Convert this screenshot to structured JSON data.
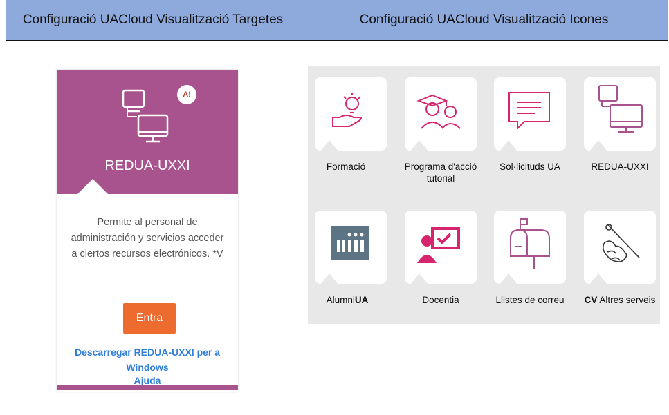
{
  "headers": {
    "left": "Configuració UACloud Visualització Targetes",
    "right": "Configuració UACloud Visualització Icones"
  },
  "card": {
    "badge": "A!",
    "title": "REDUA-UXXI",
    "description": "Permite al personal de administración y servicios acceder a ciertos recursos electrónicos. *V",
    "button": "Entra",
    "download_link": "Descarregar REDUA-UXXI per a Windows",
    "help_link": "Ajuda",
    "color": "#a8528e"
  },
  "icons": [
    {
      "label": "Formació",
      "icon": "lightbulb-hand-icon"
    },
    {
      "label": "Programa d'acció tutorial",
      "icon": "graduates-icon"
    },
    {
      "label": "Sol·licituds UA",
      "icon": "speech-bubble-icon"
    },
    {
      "label": "REDUA-UXXI",
      "icon": "computers-icon"
    },
    {
      "label_bold": "",
      "label": "Alumni",
      "label_suffix": "UA",
      "icon": "alumni-logo-icon"
    },
    {
      "label": "Docentia",
      "icon": "teacher-board-icon"
    },
    {
      "label": "Llistes de correu",
      "icon": "mailbox-icon"
    },
    {
      "label_bold": "CV",
      "label": "Altres serveis",
      "icon": "pen-hand-icon"
    }
  ],
  "colors": {
    "accent": "#d6246e",
    "header_bg": "#8ea9db",
    "button": "#ee6b2f"
  }
}
